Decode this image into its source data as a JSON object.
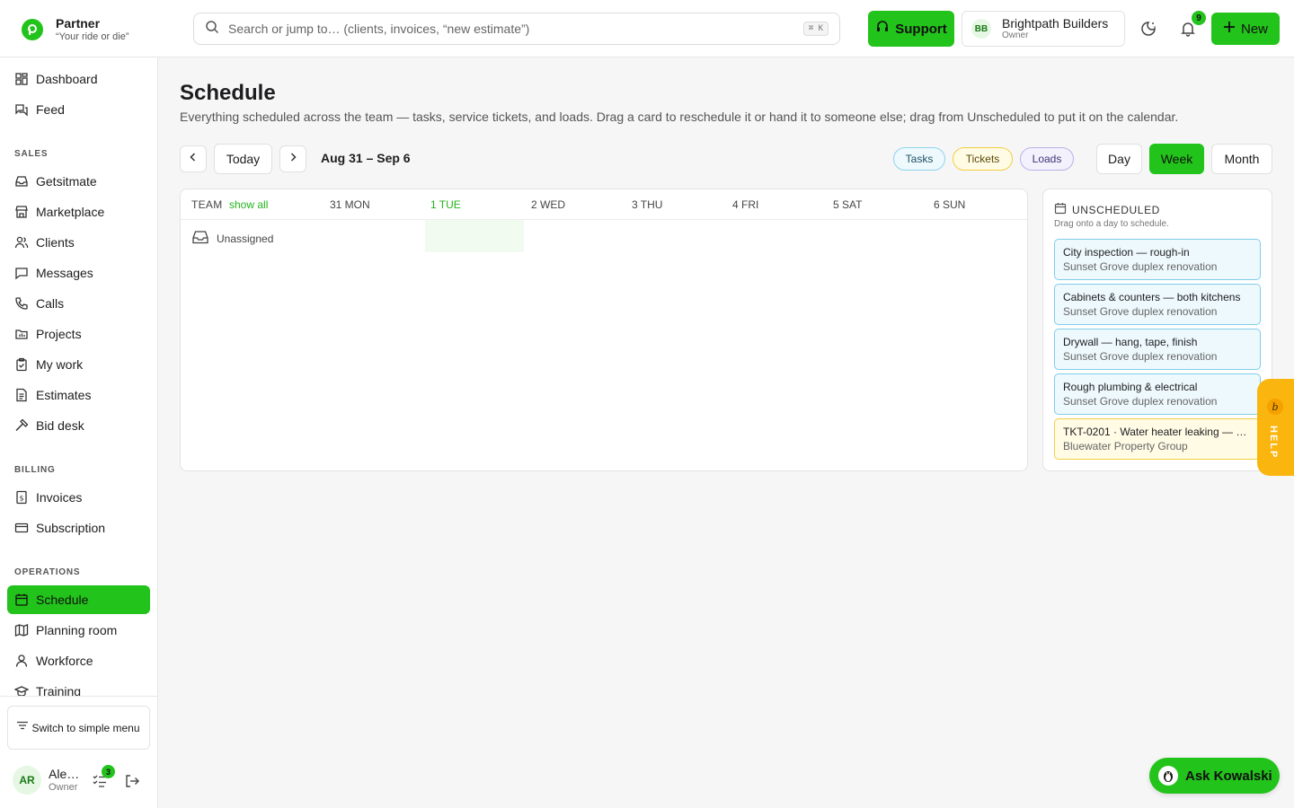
{
  "brand": {
    "name": "Partner",
    "tagline": "“Your ride or die”"
  },
  "search": {
    "placeholder": "Search or jump to… (clients, invoices, “new estimate”)",
    "shortcut": "⌘ K"
  },
  "header": {
    "support_label": "Support",
    "org": {
      "initials": "BB",
      "name": "Brightpath Builders",
      "role": "Owner"
    },
    "notifications_count": "9",
    "new_label": "New"
  },
  "sidebar": {
    "top_items": [
      {
        "label": "Dashboard",
        "icon": "dashboard-icon"
      },
      {
        "label": "Feed",
        "icon": "feed-icon"
      }
    ],
    "sales_label": "SALES",
    "sales_items": [
      {
        "label": "Getsitmate",
        "icon": "inbox-icon"
      },
      {
        "label": "Marketplace",
        "icon": "store-icon"
      },
      {
        "label": "Clients",
        "icon": "users-icon"
      },
      {
        "label": "Messages",
        "icon": "message-icon"
      },
      {
        "label": "Calls",
        "icon": "phone-icon"
      },
      {
        "label": "Projects",
        "icon": "folder-icon"
      },
      {
        "label": "My work",
        "icon": "clipboard-icon"
      },
      {
        "label": "Estimates",
        "icon": "document-icon"
      },
      {
        "label": "Bid desk",
        "icon": "gavel-icon"
      }
    ],
    "billing_label": "BILLING",
    "billing_items": [
      {
        "label": "Invoices",
        "icon": "invoice-icon"
      },
      {
        "label": "Subscription",
        "icon": "card-icon"
      }
    ],
    "operations_label": "OPERATIONS",
    "operations_items": [
      {
        "label": "Schedule",
        "icon": "calendar-icon",
        "active": true
      },
      {
        "label": "Planning room",
        "icon": "map-icon"
      },
      {
        "label": "Workforce",
        "icon": "worker-icon"
      },
      {
        "label": "Training",
        "icon": "graduation-icon"
      }
    ],
    "simple_menu_label": "Switch to simple menu",
    "user": {
      "initials": "AR",
      "name": "Ale…",
      "role": "Owner",
      "tasks_count": "3"
    }
  },
  "page": {
    "title": "Schedule",
    "subtitle": "Everything scheduled across the team — tasks, service tickets, and loads. Drag a card to reschedule it or hand it to someone else; drag from Unscheduled to put it on the calendar."
  },
  "toolbar": {
    "today_label": "Today",
    "range_label": "Aug 31 – Sep 6",
    "filters": [
      "Tasks",
      "Tickets",
      "Loads"
    ],
    "views": [
      "Day",
      "Week",
      "Month"
    ],
    "active_view": "Week"
  },
  "calendar": {
    "team_label": "TEAM",
    "show_all_label": "show all",
    "days": [
      "31 MON",
      "1 TUE",
      "2 WED",
      "3 THU",
      "4 FRI",
      "5 SAT",
      "6 SUN"
    ],
    "today_index": 1,
    "rows": [
      "Unassigned"
    ]
  },
  "unscheduled": {
    "title": "UNSCHEDULED",
    "subtitle": "Drag onto a day to schedule.",
    "cards": [
      {
        "title": "City inspection — rough-in",
        "subtitle": "Sunset Grove duplex renovation",
        "kind": "task"
      },
      {
        "title": "Cabinets & counters — both kitchens",
        "subtitle": "Sunset Grove duplex renovation",
        "kind": "task"
      },
      {
        "title": "Drywall — hang, tape, finish",
        "subtitle": "Sunset Grove duplex renovation",
        "kind": "task"
      },
      {
        "title": "Rough plumbing & electrical",
        "subtitle": "Sunset Grove duplex renovation",
        "kind": "task"
      },
      {
        "title": "TKT-0201 · Water heater leaking — s…",
        "subtitle": "Bluewater Property Group",
        "kind": "ticket"
      }
    ]
  },
  "help": {
    "logo": "b",
    "label": "HELP"
  },
  "assistant": {
    "label": "Ask Kowalski"
  },
  "colors": {
    "accent": "#22c31a",
    "task": "#7fcde9",
    "ticket": "#f2cf43",
    "load": "#b9b2e8"
  }
}
